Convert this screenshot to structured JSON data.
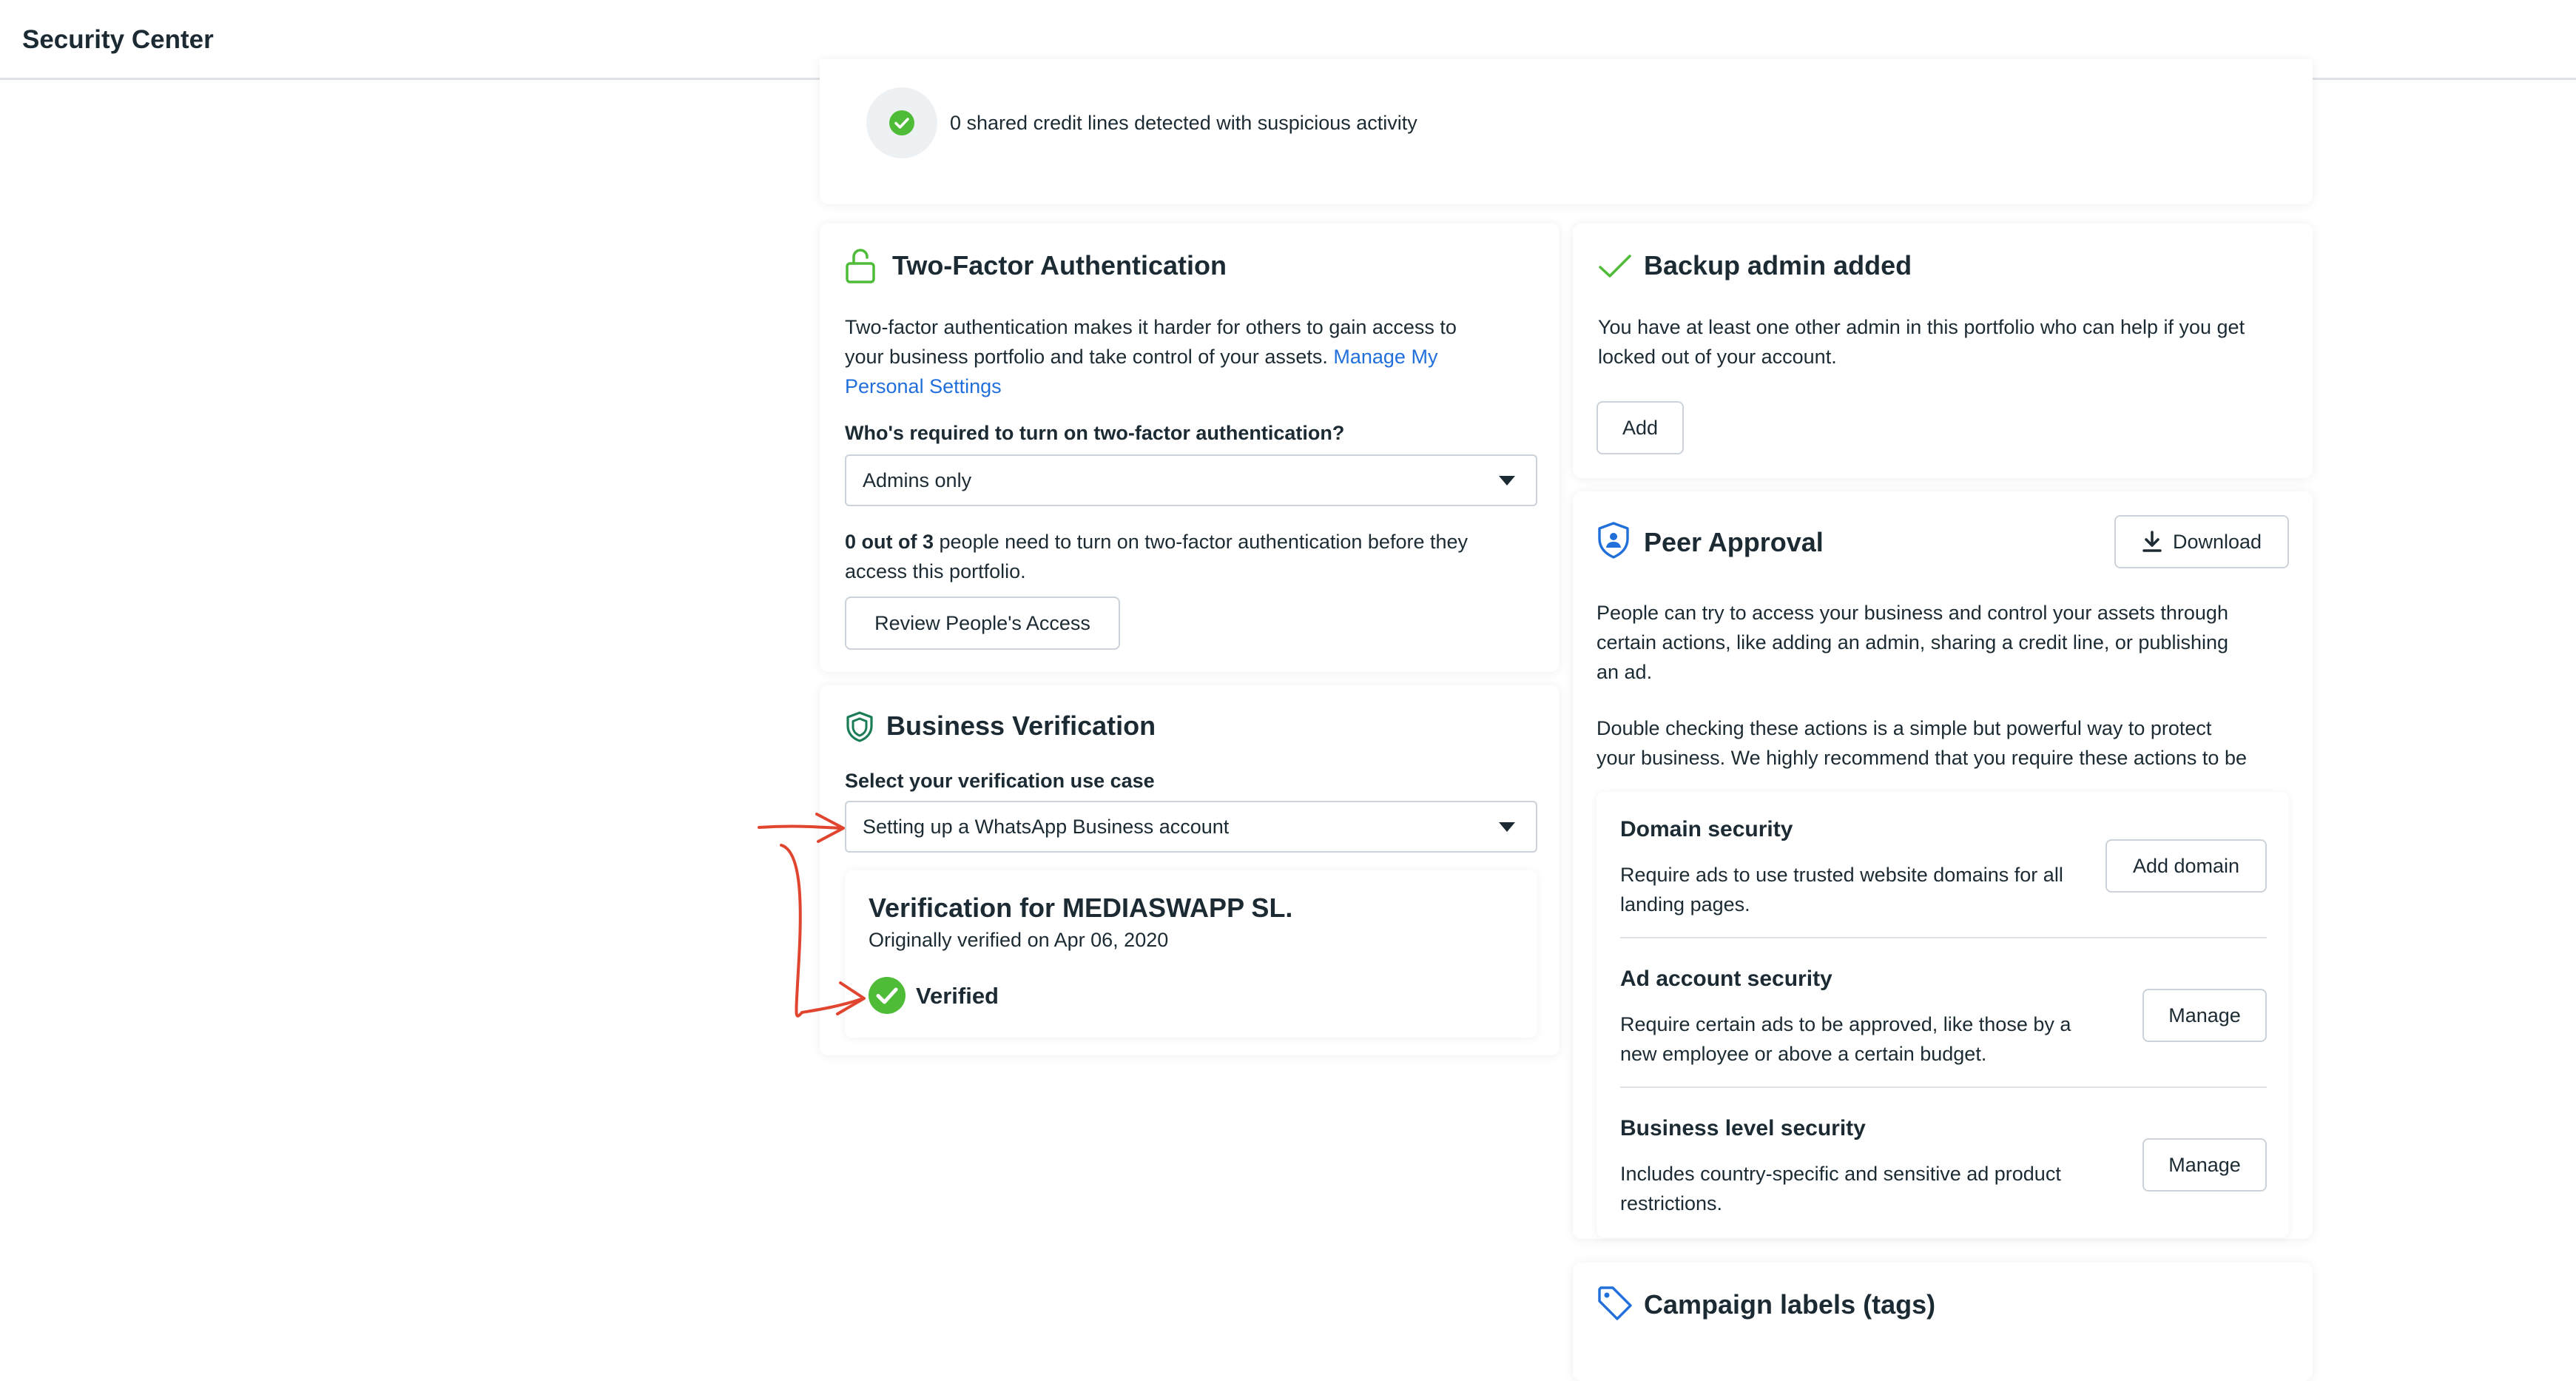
{
  "header": {
    "title": "Security Center"
  },
  "credit_lines": {
    "status_text": "0 shared credit lines detected with suspicious activity"
  },
  "two_factor": {
    "title": "Two-Factor Authentication",
    "description_line1": "Two-factor authentication makes it harder for others to gain access to",
    "description_line2": "your business portfolio and take control of your assets.",
    "link_part1": "Manage My",
    "link_part2": "Personal Settings",
    "question": "Who's required to turn on two-factor authentication?",
    "selected": "Admins only",
    "count_bold": "0 out of 3",
    "count_rest": "people need to turn on two-factor authentication before they",
    "count_line2": "access this portfolio.",
    "review_button": "Review People's Access"
  },
  "backup_admin": {
    "title": "Backup admin added",
    "description_line1": "You have at least one other admin in this portfolio who can help if you get",
    "description_line2": "locked out of your account.",
    "add_button": "Add"
  },
  "business_verification": {
    "title": "Business Verification",
    "use_case_label": "Select your verification use case",
    "selected": "Setting up a WhatsApp Business account",
    "verification_title": "Verification for MEDIASWAPP SL.",
    "verified_date": "Originally verified on Apr 06, 2020",
    "status": "Verified"
  },
  "peer_approval": {
    "title": "Peer Approval",
    "download_button": "Download",
    "para1_line1": "People can try to access your business and control your assets through",
    "para1_line2": "certain actions, like adding an admin, sharing a credit line, or publishing",
    "para1_line3": "an ad.",
    "para2_line1": "Double checking these actions is a simple but powerful way to protect",
    "para2_line2": "your business. We highly recommend that you require these actions to be",
    "sections": [
      {
        "title": "Domain security",
        "line1": "Require ads to use trusted website domains for all",
        "line2": "landing pages.",
        "button": "Add domain"
      },
      {
        "title": "Ad account security",
        "line1": "Require certain ads to be approved, like those by a",
        "line2": "new employee or above a certain budget.",
        "button": "Manage"
      },
      {
        "title": "Business level security",
        "line1": "Includes country-specific and sensitive ad product",
        "line2": "restrictions.",
        "button": "Manage"
      }
    ]
  },
  "campaign_labels": {
    "title": "Campaign labels (tags)"
  },
  "colors": {
    "accent_blue": "#216fdb",
    "success_green": "#4fbc38",
    "annotation_red": "#e0452f"
  },
  "icons": [
    "check-circle-icon",
    "unlock-icon",
    "checkmark-icon",
    "shield-icon",
    "shield-person-icon",
    "download-icon",
    "tag-icon",
    "verified-icon"
  ]
}
